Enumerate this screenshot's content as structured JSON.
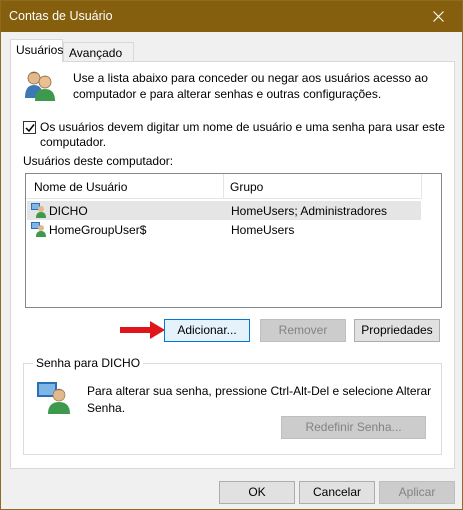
{
  "window": {
    "title": "Contas de Usuário"
  },
  "tabs": [
    {
      "label": "Usuários",
      "active": true
    },
    {
      "label": "Avançado",
      "active": false
    }
  ],
  "intro_text": "Use a lista abaixo para conceder ou negar aos usuários acesso ao computador e para alterar senhas e outras configurações.",
  "require_login": {
    "checked": true,
    "label": "Os usuários devem digitar um nome de usuário e uma senha para usar este computador."
  },
  "users_list": {
    "label": "Usuários deste computador:",
    "columns": [
      "Nome de Usuário",
      "Grupo"
    ],
    "rows": [
      {
        "name": "DICHO",
        "group": "HomeUsers; Administradores",
        "selected": true
      },
      {
        "name": "HomeGroupUser$",
        "group": "HomeUsers",
        "selected": false
      }
    ]
  },
  "list_buttons": {
    "add": "Adicionar...",
    "remove": "Remover",
    "properties": "Propriedades"
  },
  "password_group": {
    "title": "Senha para DICHO",
    "text": "Para alterar sua senha, pressione Ctrl-Alt-Del e selecione Alterar Senha.",
    "reset_button": "Redefinir Senha..."
  },
  "dialog_buttons": {
    "ok": "OK",
    "cancel": "Cancelar",
    "apply": "Aplicar"
  },
  "colors": {
    "titlebar": "#855f0d",
    "arrow": "#e0151b",
    "focus_border": "#0078d7"
  },
  "icons": [
    "close-icon",
    "users-icon",
    "user-icon",
    "checkmark-icon",
    "red-arrow-icon",
    "password-user-icon"
  ]
}
